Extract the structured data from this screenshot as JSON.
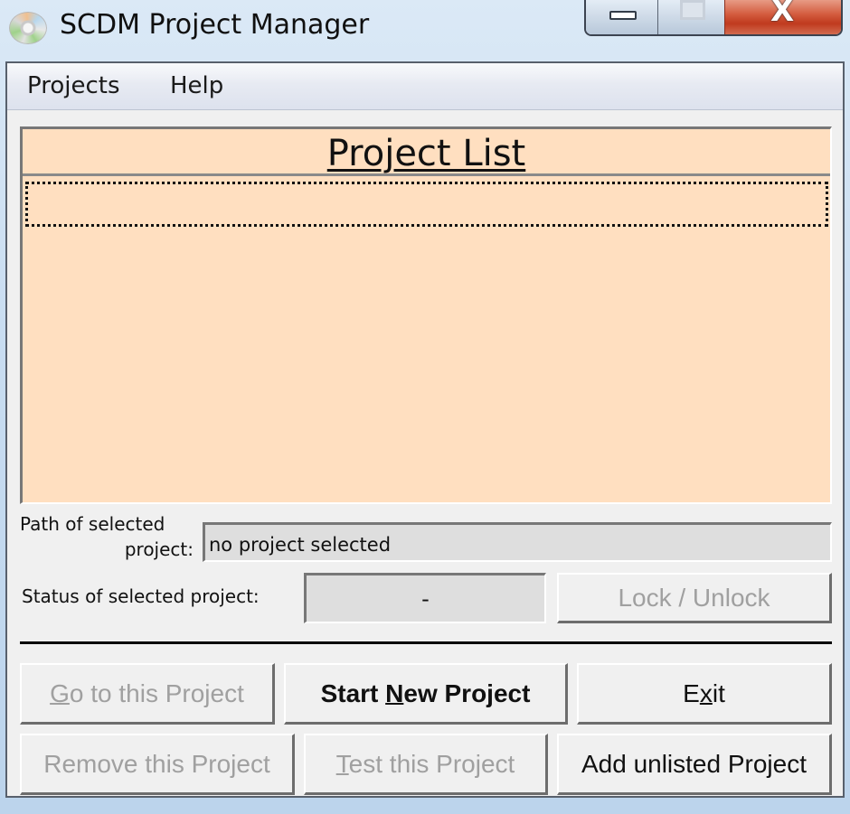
{
  "window": {
    "title": "SCDM Project Manager",
    "app_icon": "cd-disc-icon",
    "controls": {
      "minimize": "minimize-icon",
      "maximize": "maximize-icon",
      "close": "close-icon",
      "close_glyph": "X"
    }
  },
  "menubar": {
    "items": [
      {
        "label": "Projects"
      },
      {
        "label": "Help"
      }
    ]
  },
  "project_list": {
    "title": "Project List",
    "items": [],
    "background_color": "#ffdfc0"
  },
  "path": {
    "label_line1": "Path of selected",
    "label_line2": "project:",
    "value": "no project selected"
  },
  "status": {
    "label": "Status of selected project:",
    "value": "-"
  },
  "buttons": {
    "lock_unlock": {
      "label": "Lock / Unlock",
      "enabled": false
    },
    "go_to": {
      "pre": "",
      "mnemonic": "G",
      "post": "o to this Project",
      "enabled": false
    },
    "start_new": {
      "pre": "Start ",
      "mnemonic": "N",
      "post": "ew Project",
      "enabled": true
    },
    "exit": {
      "pre": "E",
      "mnemonic": "x",
      "post": "it",
      "enabled": true
    },
    "remove": {
      "label": "Remove this Project",
      "enabled": false
    },
    "test": {
      "pre": "",
      "mnemonic": "T",
      "post": "est this Project",
      "enabled": false
    },
    "add_unlisted": {
      "label": "Add unlisted Project",
      "enabled": true
    }
  }
}
